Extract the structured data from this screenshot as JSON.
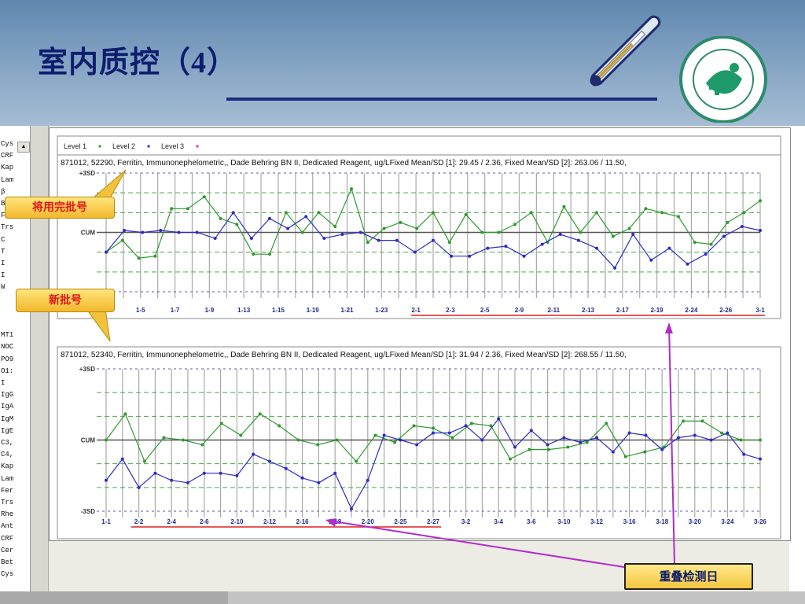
{
  "slide": {
    "title": "室内质控（4）",
    "colors": {
      "header_top": "#5f86ad",
      "title": "#0d1e6e",
      "level1": "#2e9b2e",
      "level2": "#2c2cc4",
      "level3": "#c43cc4",
      "sd_line": "#5a5ab4",
      "mid_line": "#4aa84a",
      "overlap_red": "#e02020"
    },
    "icons": {
      "thermometer": "thermometer-icon",
      "logo": "hospital-logo-icon"
    }
  },
  "callouts": {
    "used_lot": "将用完批号",
    "new_lot": "新批号",
    "overlap_days": "重叠检测日"
  },
  "app": {
    "left_panel_items": [
      "Cys",
      "CRF",
      "Kap",
      "Lam",
      "β",
      "Bet",
      "Fer",
      "Trs",
      "C",
      "T",
      "I",
      "I",
      "W",
      "",
      "",
      "",
      "MT1",
      "NOC",
      "PO9",
      "O1:",
      "I",
      "IgG",
      "IgA",
      "IgM",
      "IgE",
      "C3,",
      "C4,",
      "Kap",
      "Lam",
      "Fer",
      "Trs",
      "Rhe",
      "Ant",
      "CRF",
      "Cer",
      "Bet",
      "Cys"
    ],
    "legend": [
      {
        "label": "Level 1",
        "color": "#2e9b2e"
      },
      {
        "label": "Level 2",
        "color": "#2c2cc4"
      },
      {
        "label": "Level 3",
        "color": "#c43cc4"
      }
    ]
  },
  "chart_data": [
    {
      "type": "line",
      "header": "871012, 52290, Ferritin, Immunonephelometric,, Dade Behring BN II, Dedicated Reagent, ug/LFixed Mean/SD [1]: 29.45 / 2.36, Fixed Mean/SD [2]: 263.06 / 11.50,",
      "y_tick_labels": [
        "+3SD",
        "CUM"
      ],
      "ylim": [
        -3,
        3
      ],
      "x_tick_labels": [
        "1-1",
        "1-5",
        "1-7",
        "1-9",
        "1-13",
        "1-15",
        "1-19",
        "1-21",
        "1-23",
        "2-1",
        "2-3",
        "2-5",
        "2-9",
        "2-11",
        "2-13",
        "2-17",
        "2-19",
        "2-24",
        "2-26",
        "3-1"
      ],
      "overlap_from_tick": 9,
      "series": [
        {
          "name": "Level 1",
          "values": [
            -1.0,
            -0.4,
            -1.3,
            -1.2,
            1.2,
            1.2,
            1.8,
            0.7,
            0.4,
            -1.1,
            -1.1,
            1.0,
            0.0,
            1.0,
            0.3,
            2.2,
            -0.5,
            0.2,
            0.5,
            0.2,
            1.0,
            -0.5,
            0.9,
            0.0,
            0.0,
            0.4,
            1.0,
            -0.5,
            1.3,
            0.0,
            1.0,
            -0.2,
            0.2,
            1.2,
            1.0,
            0.8,
            -0.5,
            -0.6,
            0.5,
            1.0,
            1.6
          ]
        },
        {
          "name": "Level 2",
          "values": [
            -1.0,
            0.1,
            0.0,
            0.1,
            0.0,
            0.0,
            -0.3,
            1.0,
            -0.3,
            0.7,
            0.2,
            0.8,
            -0.3,
            -0.1,
            0.0,
            -0.4,
            -0.4,
            -1.0,
            -0.4,
            -1.2,
            -1.2,
            -0.8,
            -0.7,
            -1.2,
            -0.6,
            -0.1,
            -0.4,
            -0.8,
            -1.8,
            -0.1,
            -1.4,
            -0.8,
            -1.6,
            -1.1,
            -0.2,
            0.3,
            0.1
          ]
        }
      ]
    },
    {
      "type": "line",
      "header": "871012, 52340, Ferritin, Immunonephelometric,, Dade Behring BN II, Dedicated Reagent, ug/LFixed Mean/SD [1]: 31.94 / 2.36, Fixed Mean/SD [2]: 268.55 / 11.50,",
      "y_tick_labels": [
        "+3SD",
        "CUM",
        "-3SD"
      ],
      "ylim": [
        -3,
        3
      ],
      "x_tick_labels": [
        "1-1",
        "2-2",
        "2-4",
        "2-6",
        "2-10",
        "2-12",
        "2-16",
        "2-18",
        "2-20",
        "2-25",
        "2-27",
        "3-2",
        "3-4",
        "3-6",
        "3-10",
        "3-12",
        "3-16",
        "3-18",
        "3-20",
        "3-24",
        "3-26"
      ],
      "overlap_to_tick": 10,
      "series": [
        {
          "name": "Level 1",
          "values": [
            0.0,
            1.1,
            -0.9,
            0.1,
            0.0,
            -0.2,
            0.7,
            0.2,
            1.1,
            0.6,
            0.0,
            -0.2,
            0.0,
            -0.9,
            0.2,
            -0.1,
            0.6,
            0.5,
            0.1,
            0.7,
            0.6,
            -0.8,
            -0.4,
            -0.4,
            -0.3,
            -0.1,
            0.7,
            -0.7,
            -0.5,
            -0.3,
            0.8,
            0.8,
            0.3,
            0.0,
            0.0
          ]
        },
        {
          "name": "Level 2",
          "values": [
            -1.7,
            -0.8,
            -2.0,
            -1.4,
            -1.7,
            -1.8,
            -1.4,
            -1.4,
            -1.5,
            -0.6,
            -0.9,
            -1.2,
            -1.6,
            -1.8,
            -1.4,
            -2.9,
            -1.7,
            0.2,
            0.0,
            -0.2,
            0.3,
            0.3,
            0.6,
            0.0,
            0.9,
            -0.3,
            0.4,
            -0.2,
            0.1,
            -0.1,
            0.1,
            -0.5,
            0.3,
            0.2,
            -0.4,
            0.1,
            0.2,
            0.0,
            0.3,
            -0.6,
            -0.8
          ]
        }
      ]
    }
  ]
}
